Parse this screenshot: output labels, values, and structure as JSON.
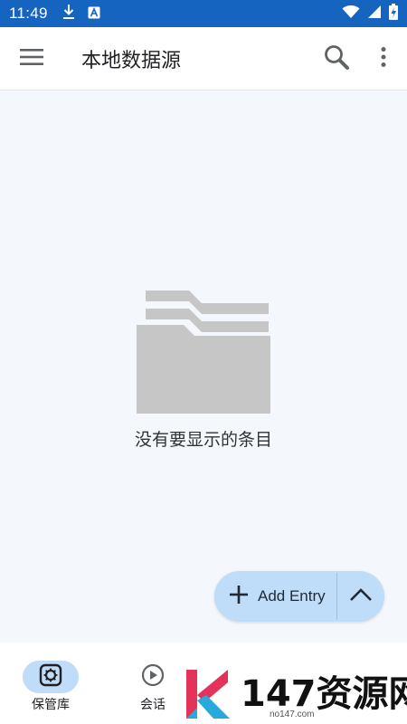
{
  "status_bar": {
    "time": "11:49",
    "left_icons": [
      "download-icon",
      "a-badge-icon"
    ],
    "right_icons": [
      "wifi-icon",
      "signal-icon",
      "battery-icon"
    ],
    "bg_color": "#1565c0"
  },
  "app_bar": {
    "title": "本地数据源",
    "left_icon": "menu-icon",
    "actions": [
      "search-icon",
      "more-vert-icon"
    ]
  },
  "empty_state": {
    "icon": "folder-stack-icon",
    "message": "没有要显示的条目"
  },
  "fab": {
    "label": "Add Entry",
    "icon": "plus-icon",
    "toggle_icon": "chevron-up-icon",
    "bg_color": "#bfdcf8"
  },
  "bottom_nav": {
    "items": [
      {
        "label": "保管库",
        "icon": "vault-icon",
        "active": true
      },
      {
        "label": "会话",
        "icon": "play-circle-icon",
        "active": false
      }
    ]
  },
  "watermark": {
    "text": "147资源网",
    "url": "no147.com"
  }
}
